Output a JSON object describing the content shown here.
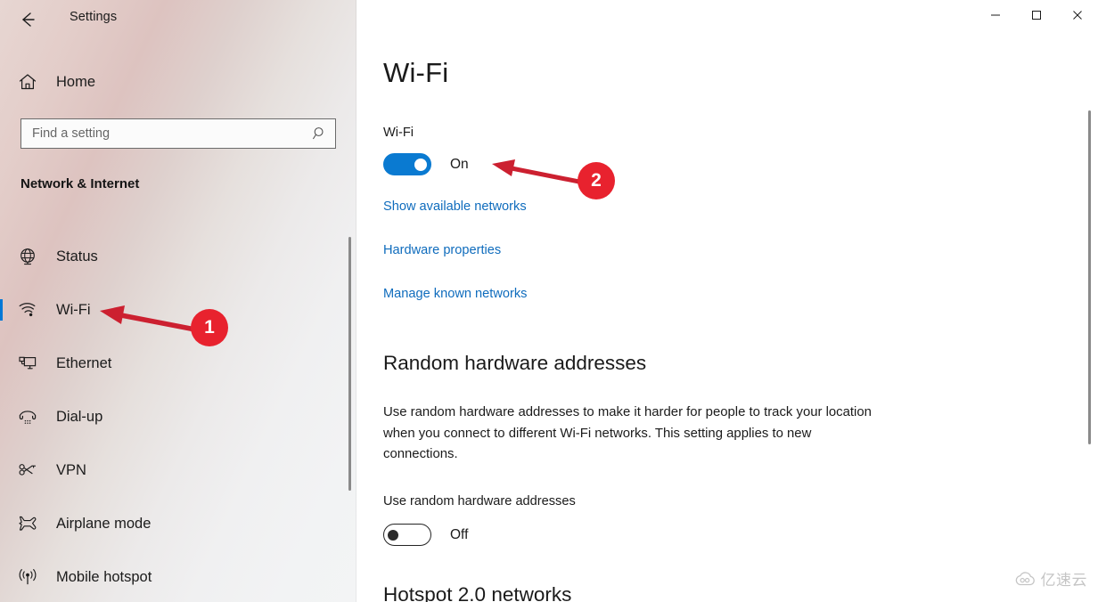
{
  "window": {
    "app_title": "Settings",
    "back_icon": "back-arrow-icon",
    "controls": {
      "minimize_label": "Minimize",
      "maximize_label": "Maximize",
      "close_label": "Close"
    }
  },
  "sidebar": {
    "home": {
      "label": "Home",
      "icon": "home-icon"
    },
    "search": {
      "value": "",
      "placeholder": "Find a setting",
      "icon": "search-icon"
    },
    "category_heading": "Network & Internet",
    "items": [
      {
        "label": "Status",
        "icon": "globe-icon",
        "selected": false
      },
      {
        "label": "Wi-Fi",
        "icon": "wifi-icon",
        "selected": true
      },
      {
        "label": "Ethernet",
        "icon": "ethernet-icon",
        "selected": false
      },
      {
        "label": "Dial-up",
        "icon": "dialup-phone-icon",
        "selected": false
      },
      {
        "label": "VPN",
        "icon": "vpn-key-icon",
        "selected": false
      },
      {
        "label": "Airplane mode",
        "icon": "airplane-icon",
        "selected": false
      },
      {
        "label": "Mobile hotspot",
        "icon": "hotspot-icon",
        "selected": false
      }
    ]
  },
  "main": {
    "page_title": "Wi-Fi",
    "wifi": {
      "label": "Wi-Fi",
      "toggle_state": "On",
      "toggle_on": true
    },
    "links": [
      {
        "label": "Show available networks"
      },
      {
        "label": "Hardware properties"
      },
      {
        "label": "Manage known networks"
      }
    ],
    "random_hardware": {
      "heading": "Random hardware addresses",
      "description": "Use random hardware addresses to make it harder for people to track your location when you connect to different Wi-Fi networks. This setting applies to new connections.",
      "toggle_label": "Use random hardware addresses",
      "toggle_state": "Off",
      "toggle_on": false
    },
    "hotspot_heading": "Hotspot 2.0 networks"
  },
  "annotations": [
    {
      "number": "1",
      "target": "sidebar-item-wi-fi"
    },
    {
      "number": "2",
      "target": "wifi-toggle"
    }
  ],
  "watermark": {
    "text": "亿速云",
    "icon": "cloud-icon"
  },
  "colors": {
    "accent": "#0078d7",
    "toggle_on": "#0a7ad1",
    "link": "#0f6cbd",
    "annotation_red": "#e8222e"
  }
}
